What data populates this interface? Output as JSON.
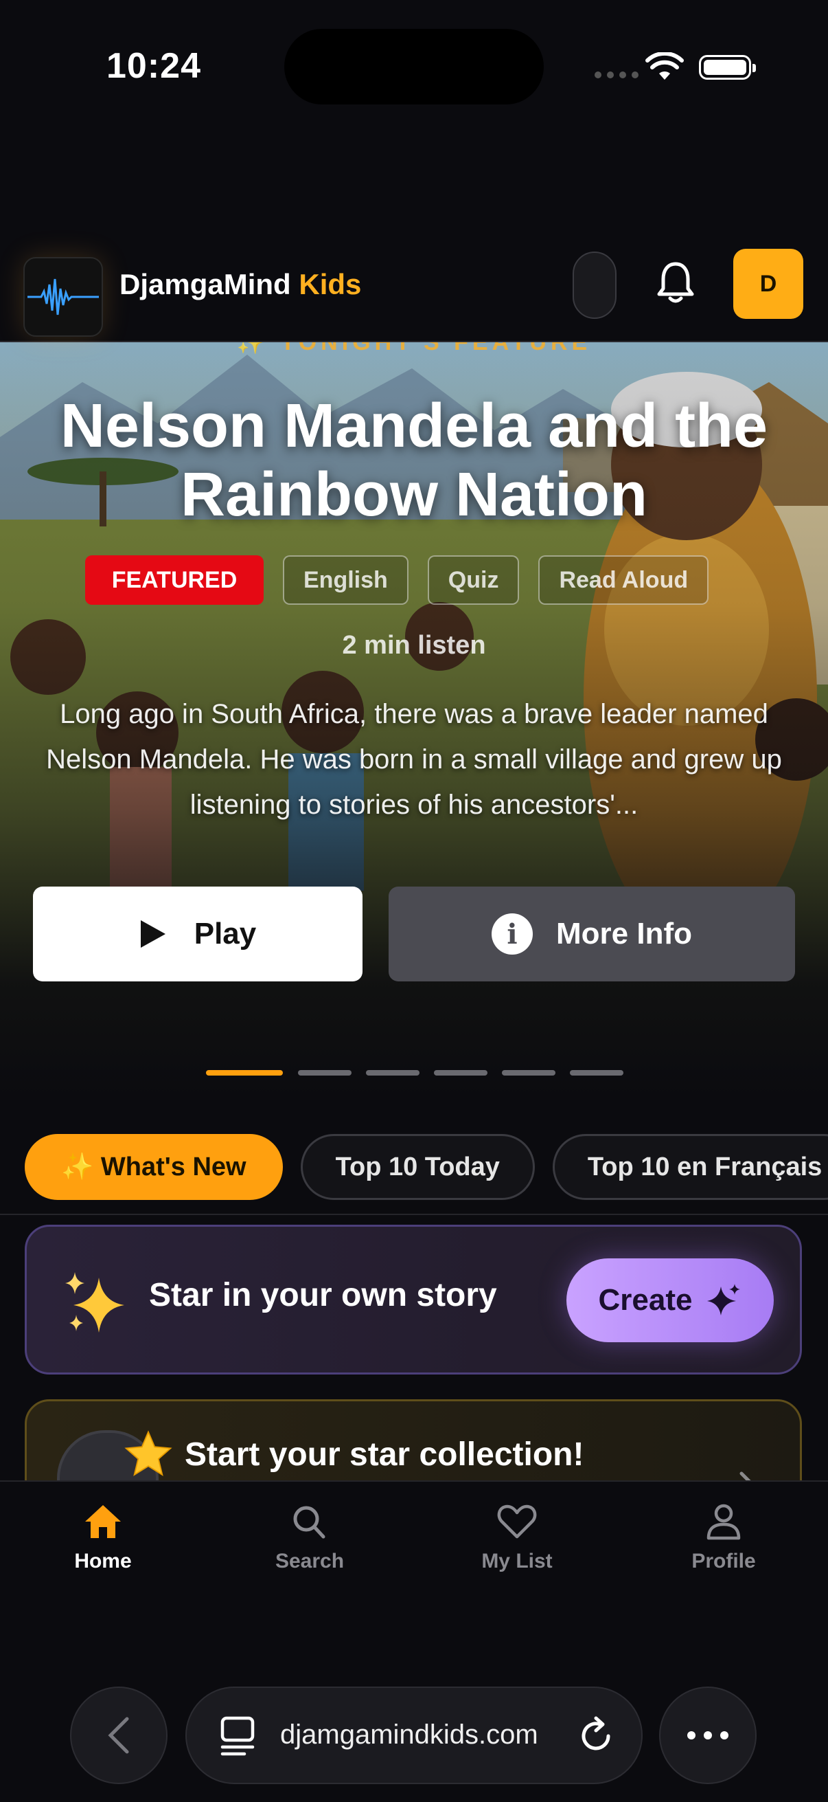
{
  "status": {
    "time": "10:24"
  },
  "header": {
    "brand_part1": "DjamgaMind ",
    "brand_part2": "Kids",
    "avatar_letter": "D"
  },
  "hero": {
    "kicker": "✨ TONIGHT'S FEATURE",
    "title": "Nelson Mandela and the Rainbow Nation",
    "tags": [
      "FEATURED",
      "English",
      "Quiz",
      "Read Aloud"
    ],
    "listen": "2 min listen",
    "summary": "Long ago in South Africa, there was a brave leader named Nelson Mandela. He was born in a small village and grew up listening to stories of his ancestors'...",
    "play_label": "Play",
    "info_label": "More Info",
    "carousel_active_index": 0,
    "carousel_count": 6
  },
  "chips": [
    "✨ What's New",
    "Top 10 Today",
    "Top 10 en Français"
  ],
  "create_card": {
    "text": "Star in your own story",
    "button": "Create"
  },
  "star_card": {
    "title": "Start your star collection!"
  },
  "tabbar": [
    "Home",
    "Search",
    "My List",
    "Profile"
  ],
  "browser": {
    "url": "djamgamindkids.com"
  },
  "colors": {
    "accent": "#ffa00f",
    "featured_red": "#e50914",
    "create_purple": "#b48cff"
  }
}
